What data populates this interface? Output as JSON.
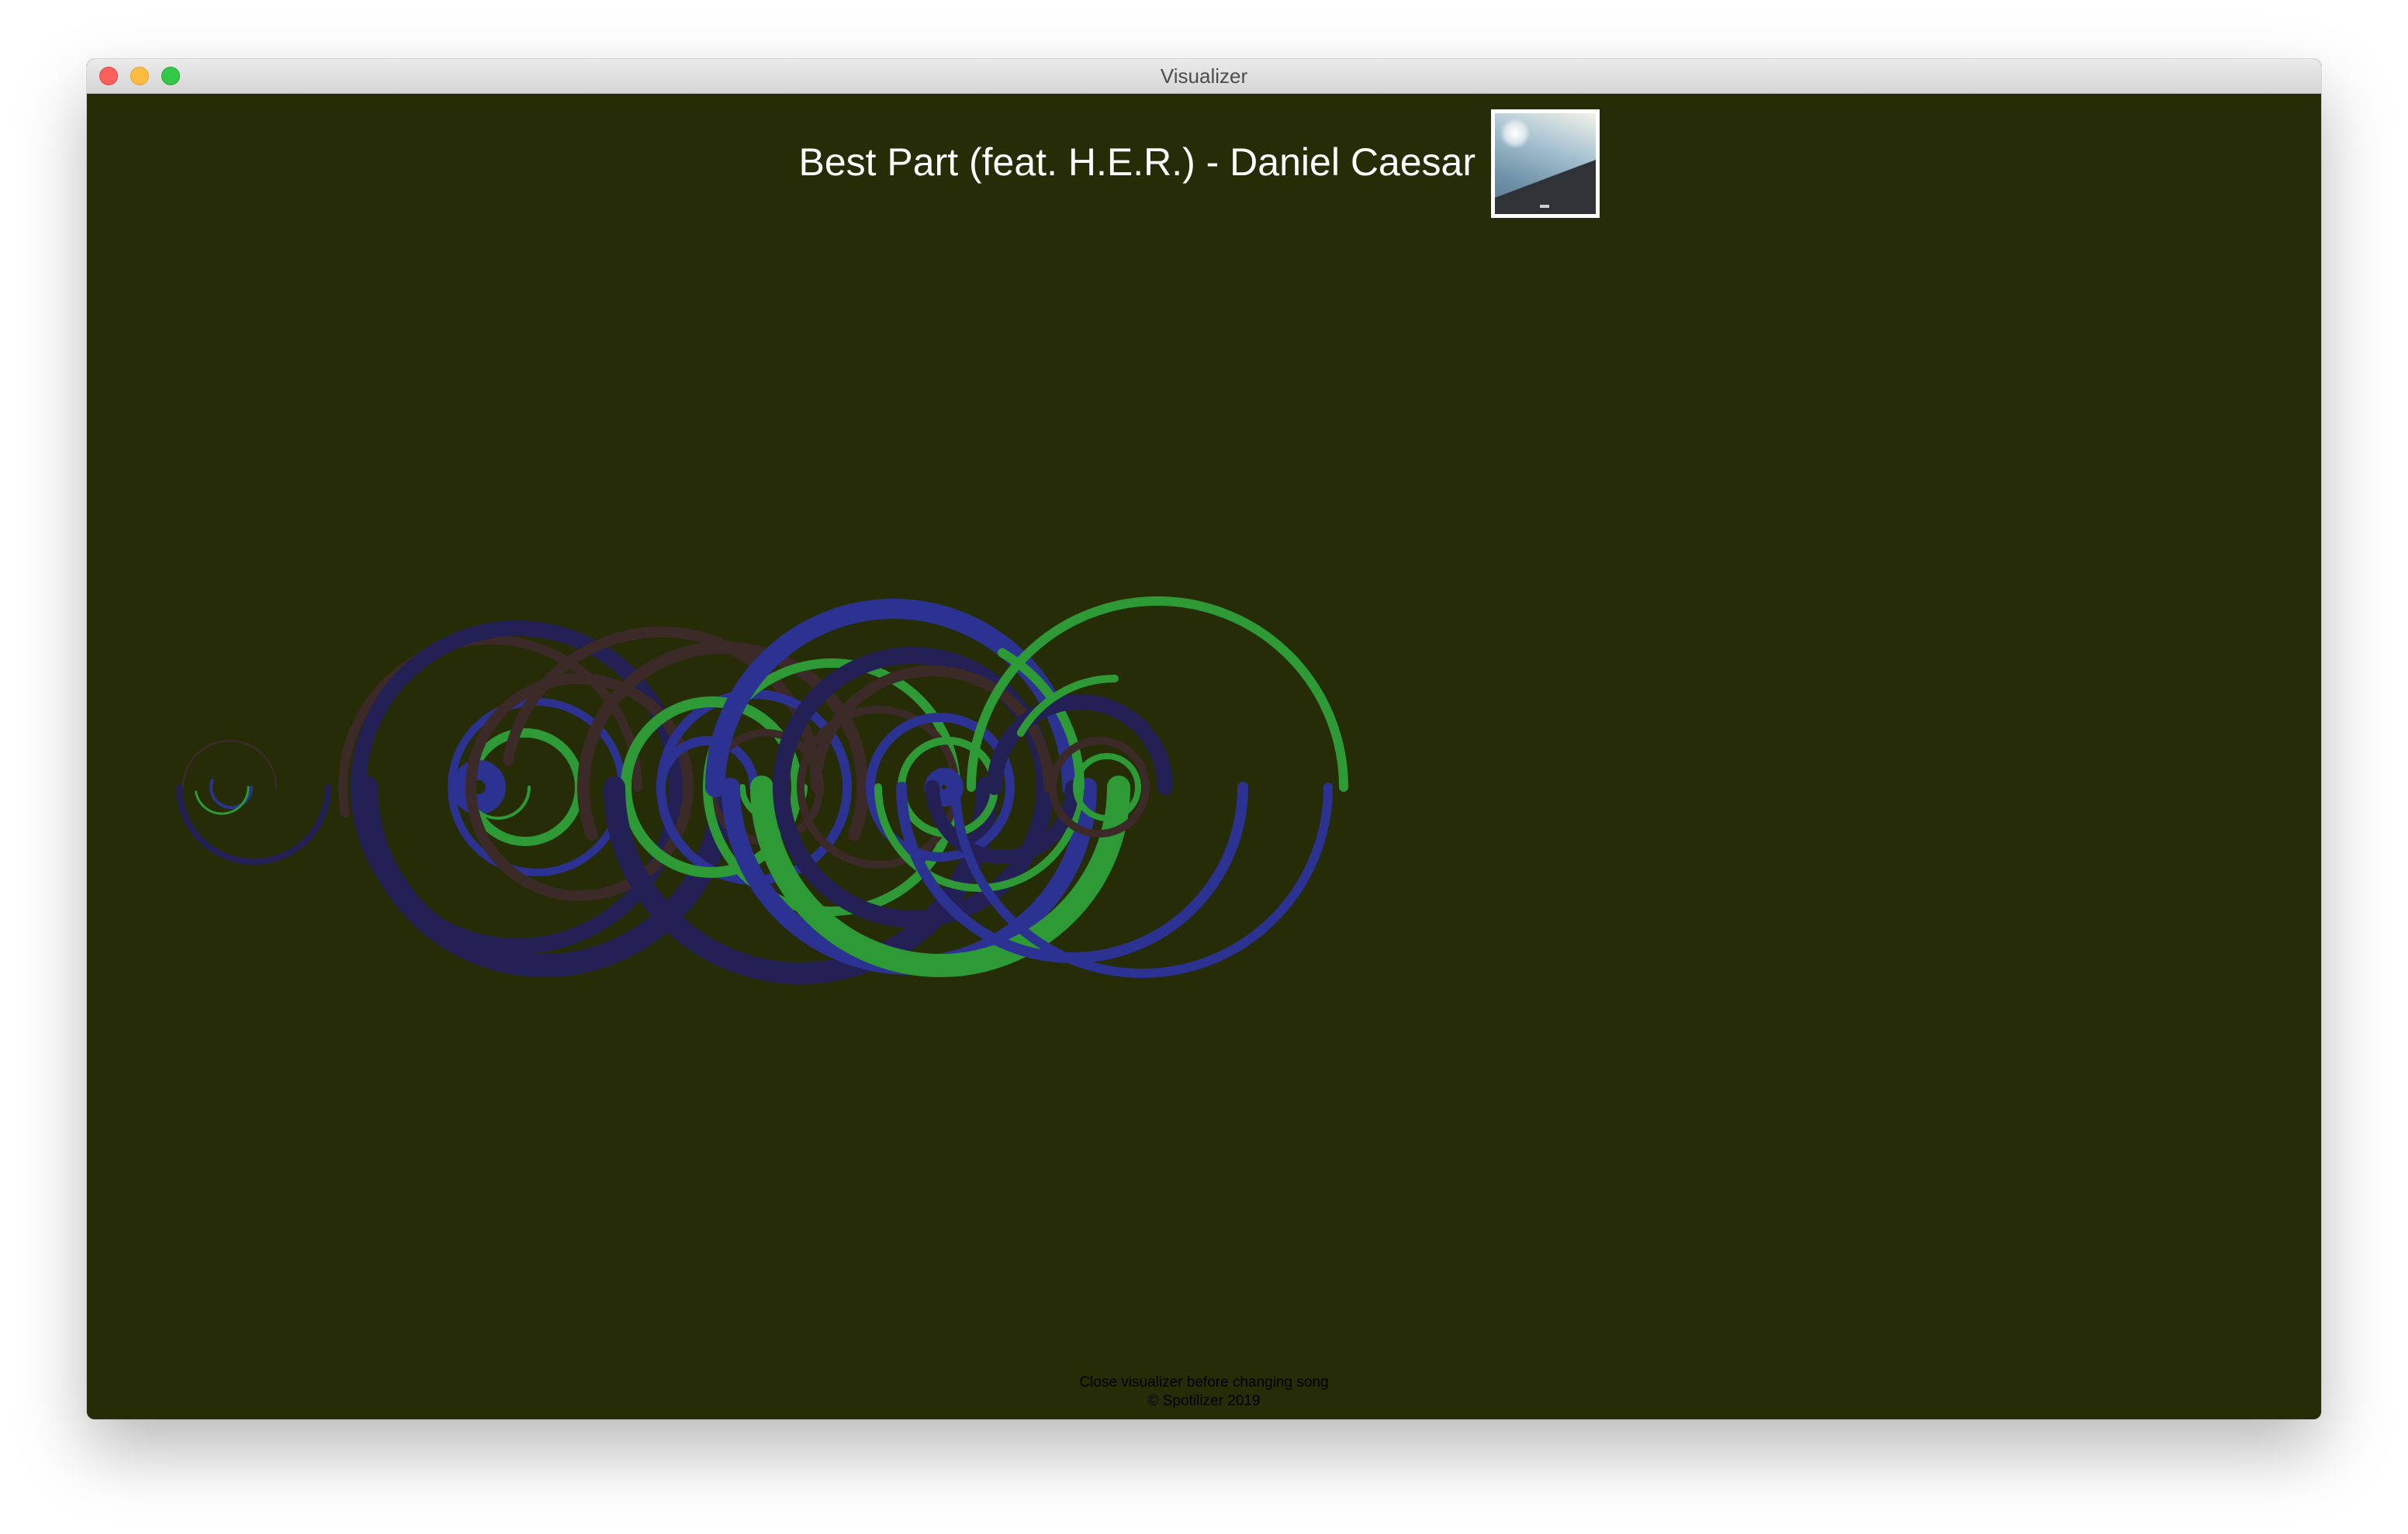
{
  "window": {
    "title": "Visualizer",
    "controls": [
      "close",
      "minimize",
      "zoom"
    ]
  },
  "now_playing": {
    "title": "Best Part (feat. H.E.R.) - Daniel Caesar",
    "album_art_icon": "album-cover-image"
  },
  "visualizer": {
    "background": "#262c05",
    "palette": {
      "green": "#2e9a36",
      "blue": "#2b3291",
      "navy": "#222054",
      "brown": "#3b2a27"
    }
  },
  "footer": {
    "notice": "Close visualizer before changing song",
    "copyright": "© Spotilizer 2019"
  }
}
